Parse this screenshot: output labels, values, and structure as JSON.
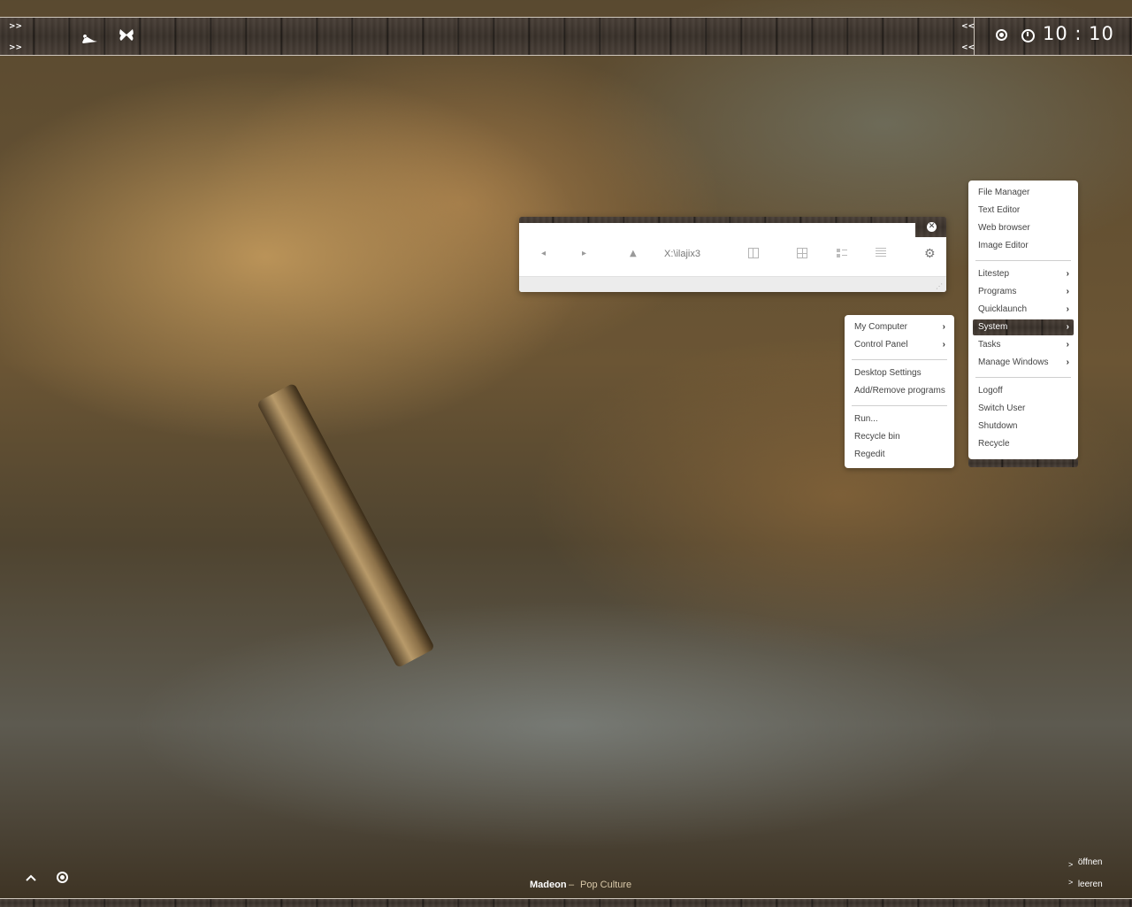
{
  "topbar": {
    "left_arrows": [
      ">>",
      ">>"
    ],
    "right_arrows": [
      "<<",
      "<<"
    ],
    "left_icons": [
      "pinup-figure-icon",
      "butterfly-icon"
    ],
    "clock": "10 : 10"
  },
  "explorer": {
    "back": "◂",
    "forward": "▸",
    "up": "▲",
    "path": "X:\\ilajix3",
    "views": [
      "columns-view-icon",
      "tiles-view-icon",
      "details-view-icon",
      "list-view-icon"
    ],
    "close": "✕"
  },
  "main_menu": {
    "items_top": [
      "File Manager",
      "Text Editor",
      "Web browser",
      "Image Editor"
    ],
    "items_sub": [
      "Litestep",
      "Programs",
      "Quicklaunch",
      "System",
      "Tasks",
      "Manage Windows"
    ],
    "selected": "System",
    "items_bottom": [
      "Logoff",
      "Switch User",
      "Shutdown",
      "Recycle"
    ]
  },
  "system_menu": {
    "items_sub": [
      "My Computer",
      "Control Panel"
    ],
    "items_mid": [
      "Desktop Settings",
      "Add/Remove programs"
    ],
    "items_bottom": [
      "Run...",
      "Recycle bin",
      "Regedit"
    ]
  },
  "now_playing": {
    "artist": "Madeon",
    "separator": "–",
    "title": "Pop Culture"
  },
  "recycle_actions": [
    "öffnen",
    "leeren"
  ],
  "colors": {
    "accent_text": "#ffffff",
    "now_playing_title": "#d8c8a8",
    "menu_text": "#444444"
  }
}
